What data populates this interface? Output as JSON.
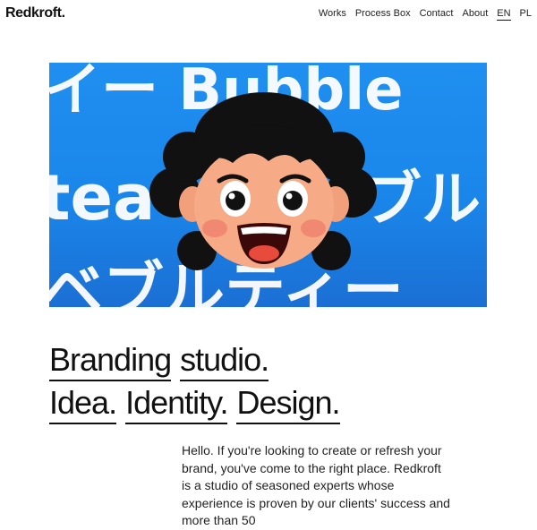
{
  "brand": {
    "logo": "Redkroft."
  },
  "nav": {
    "items": [
      "Works",
      "Process Box",
      "Contact",
      "About",
      "EN",
      "PL"
    ],
    "active_lang": "EN"
  },
  "hero": {
    "background_color": "#1f8ff0",
    "overlay_text": [
      "イー Bubble",
      "tea",
      "ブル",
      "ベブルティー"
    ]
  },
  "headline": {
    "words_line1": [
      "Branding",
      "studio."
    ],
    "words_line2": [
      "Idea.",
      "Identity.",
      "Design."
    ]
  },
  "intro": {
    "text": "Hello. If you're looking to create or refresh your brand, you've come to the right place. Redkroft is a studio of seasoned experts whose experience is proven by our clients' success and more than 50"
  }
}
